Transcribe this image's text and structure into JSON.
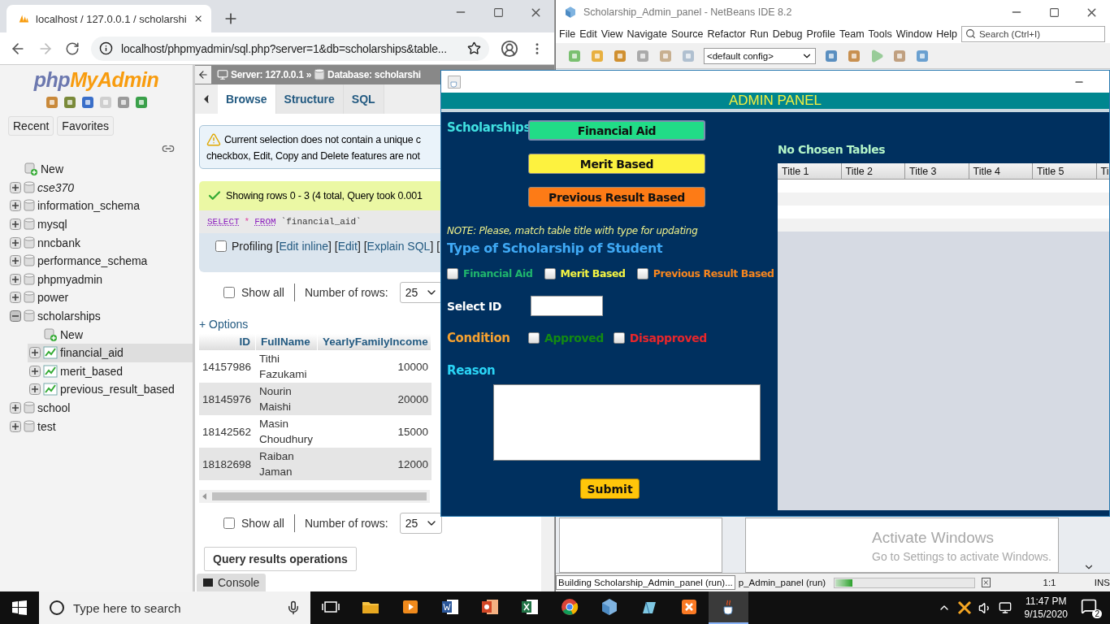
{
  "browser": {
    "tab_title": "localhost / 127.0.0.1 / scholarshi",
    "url": "localhost/phpmyadmin/sql.php?server=1&db=scholarships&table...",
    "sidebar": {
      "logo": [
        "php",
        "MyAdmin"
      ],
      "buttons": [
        "Recent",
        "Favorites"
      ],
      "tree": [
        {
          "label": "New",
          "kind": "new",
          "selected": false,
          "emphasized": false
        },
        {
          "label": "cse370",
          "kind": "db",
          "expanded": false,
          "selected": false,
          "emphasized": true
        },
        {
          "label": "information_schema",
          "kind": "db",
          "expanded": false,
          "selected": false,
          "emphasized": false
        },
        {
          "label": "mysql",
          "kind": "db",
          "expanded": false,
          "selected": false,
          "emphasized": false
        },
        {
          "label": "nncbank",
          "kind": "db",
          "expanded": false,
          "selected": false,
          "emphasized": false
        },
        {
          "label": "performance_schema",
          "kind": "db",
          "expanded": false,
          "selected": false,
          "emphasized": false
        },
        {
          "label": "phpmyadmin",
          "kind": "db",
          "expanded": false,
          "selected": false,
          "emphasized": false
        },
        {
          "label": "power",
          "kind": "db",
          "expanded": false,
          "selected": false,
          "emphasized": false
        },
        {
          "label": "scholarships",
          "kind": "db",
          "expanded": true,
          "selected": false,
          "emphasized": false,
          "children": [
            {
              "label": "New",
              "kind": "new",
              "selected": false,
              "emphasized": false
            },
            {
              "label": "financial_aid",
              "kind": "table",
              "expanded": false,
              "selected": true,
              "emphasized": false
            },
            {
              "label": "merit_based",
              "kind": "table",
              "expanded": false,
              "selected": false,
              "emphasized": false
            },
            {
              "label": "previous_result_based",
              "kind": "table",
              "expanded": false,
              "selected": false,
              "emphasized": false
            }
          ]
        },
        {
          "label": "school",
          "kind": "db",
          "expanded": false,
          "selected": false,
          "emphasized": false
        },
        {
          "label": "test",
          "kind": "db",
          "expanded": false,
          "selected": false,
          "emphasized": false
        }
      ]
    },
    "breadcrumb": [
      "Server: 127.0.0.1 »",
      "Database: scholarshi"
    ],
    "tabs": [
      {
        "label": "Browse",
        "selected": true
      },
      {
        "label": "Structure",
        "selected": false
      },
      {
        "label": "SQL",
        "selected": false
      }
    ],
    "warning": [
      "Current selection does not contain a unique c",
      "checkbox, Edit, Copy and Delete features are not"
    ],
    "success": "Showing rows 0 - 3 (4 total, Query took 0.001",
    "sql": [
      {
        "text": "SELECT",
        "kind": "keyword"
      },
      {
        "text": "*",
        "kind": "operator"
      },
      {
        "text": "FROM",
        "kind": "keyword"
      },
      {
        "text": "`financial_aid`",
        "kind": "identifier"
      }
    ],
    "profiling": {
      "label": "Profiling",
      "checked": false,
      "parts": [
        {
          "text": "[",
          "kind": "plain"
        },
        {
          "text": "Edit inline",
          "kind": "link"
        },
        {
          "text": "] [",
          "kind": "plain"
        },
        {
          "text": "Edit",
          "kind": "link"
        },
        {
          "text": "] [",
          "kind": "plain"
        },
        {
          "text": "Explain SQL",
          "kind": "link"
        },
        {
          "text": "] [",
          "kind": "plain"
        }
      ]
    },
    "pagers": [
      {
        "show_all": "Show all",
        "checked": false,
        "rows_label": "Number of rows:",
        "rows_value": "25"
      },
      {
        "show_all": "Show all",
        "checked": false,
        "rows_label": "Number of rows:",
        "rows_value": "25"
      }
    ],
    "options": "+ Options",
    "table": {
      "columns": [
        "ID",
        "FullName",
        "YearlyFamilyIncome"
      ],
      "rows": [
        [
          "14157986",
          "Tithi Fazukami",
          "10000"
        ],
        [
          "18145976",
          "Nourin Maishi",
          "20000"
        ],
        [
          "18142562",
          "Masin Choudhury",
          "15000"
        ],
        [
          "18182698",
          "Raiban Jaman",
          "12000"
        ]
      ]
    },
    "operations": "Query results operations",
    "console": "Console"
  },
  "netbeans": {
    "title": "Scholarship_Admin_panel - NetBeans IDE 8.2",
    "menu": [
      "File",
      "Edit",
      "View",
      "Navigate",
      "Source",
      "Refactor",
      "Run",
      "Debug",
      "Profile",
      "Team",
      "Tools",
      "Window",
      "Help"
    ],
    "search_placeholder": "Search (Ctrl+I)",
    "config": "<default config>",
    "status": {
      "task": "Building Scholarship_Admin_panel (run)...",
      "task_behind": "p_Admin_panel (run)",
      "level": 0.12,
      "position": "1:1",
      "mode": "INS"
    }
  },
  "admin": {
    "header": "ADMIN PANEL",
    "scholarships_label": "Scholarships",
    "scholarship_buttons": [
      {
        "label": "Financial Aid",
        "color": "#21dc87",
        "selected": true
      },
      {
        "label": "Merit Based",
        "color": "#fdf23f",
        "selected": false
      },
      {
        "label": "Previous Result Based",
        "color": "#fd7b16",
        "selected": false
      }
    ],
    "note": "NOTE: Please, match table title with type for updating",
    "type_heading": "Type of Scholarship of Student",
    "types": [
      {
        "label": "Financial Aid",
        "checked": false,
        "color": "#1fb56d"
      },
      {
        "label": "Merit Based",
        "checked": false,
        "color": "#f5f542"
      },
      {
        "label": "Previous Result Based",
        "checked": false,
        "color": "#f7861e"
      }
    ],
    "select_id_label": "Select ID",
    "condition_label": "Condition",
    "conditions": [
      {
        "label": "Approved",
        "checked": false,
        "color": "#138a13"
      },
      {
        "label": "Disapproved",
        "checked": false,
        "color": "#e8262b"
      }
    ],
    "reason_label": "Reason",
    "submit": "Submit",
    "tables_heading": "No Chosen Tables",
    "table_columns": [
      "Title 1",
      "Title 2",
      "Title 3",
      "Title 4",
      "Title 5",
      "Ti"
    ]
  },
  "activation": [
    "Activate Windows",
    "Go to Settings to activate Windows."
  ],
  "taskbar": {
    "search_placeholder": "Type here to search",
    "apps": [
      {
        "kind": "taskview",
        "selected": false
      },
      {
        "kind": "folder",
        "selected": false
      },
      {
        "kind": "media",
        "selected": false
      },
      {
        "kind": "word",
        "selected": false
      },
      {
        "kind": "slides",
        "selected": false
      },
      {
        "kind": "sheet",
        "selected": false
      },
      {
        "kind": "browser",
        "selected": false
      },
      {
        "kind": "cube",
        "selected": false
      },
      {
        "kind": "pen",
        "selected": false
      },
      {
        "kind": "server",
        "selected": false
      },
      {
        "kind": "java",
        "selected": true
      }
    ],
    "time": "11:47 PM",
    "date": "9/15/2020",
    "notifications": "2"
  }
}
